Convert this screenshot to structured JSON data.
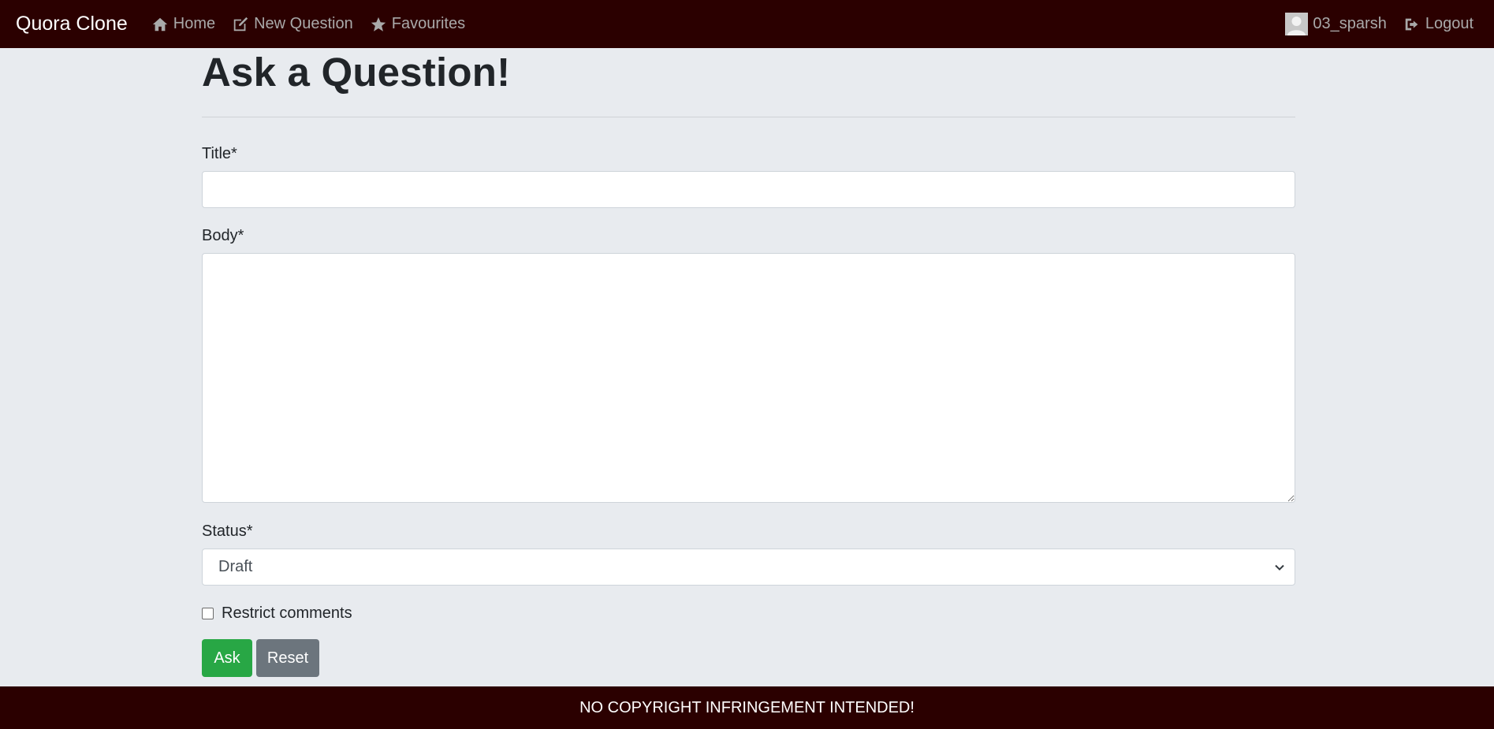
{
  "navbar": {
    "brand": "Quora Clone",
    "links": [
      {
        "label": "Home",
        "icon": "home-icon"
      },
      {
        "label": "New Question",
        "icon": "edit-icon"
      },
      {
        "label": "Favourites",
        "icon": "star-icon"
      }
    ],
    "user": {
      "username": "03_sparsh",
      "avatar": "avatar-placeholder"
    },
    "logout": {
      "label": "Logout",
      "icon": "logout-icon"
    }
  },
  "page": {
    "title": "Ask a Question!"
  },
  "form": {
    "title_label": "Title*",
    "title_value": "",
    "body_label": "Body*",
    "body_value": "",
    "status_label": "Status*",
    "status_value": "Draft",
    "restrict_comments_label": "Restrict comments",
    "restrict_comments_checked": false,
    "ask_label": "Ask",
    "reset_label": "Reset"
  },
  "footer": {
    "text": "NO COPYRIGHT INFRINGEMENT INTENDED!"
  },
  "colors": {
    "navbar_bg": "#2b0000",
    "page_bg": "#e8ebef",
    "ask_button": "#28a745",
    "reset_button": "#6c757d"
  }
}
